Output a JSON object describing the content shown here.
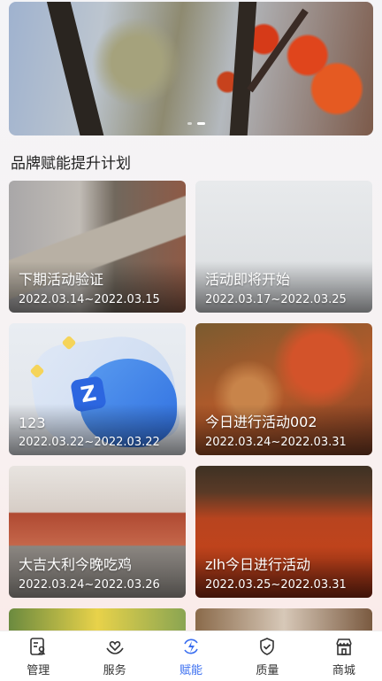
{
  "banner": {
    "slide_count": 2,
    "active_index": 1
  },
  "section_title": "品牌赋能提升计划",
  "cards": [
    {
      "name": "下期活动验证",
      "date": "2022.03.14~2022.03.15"
    },
    {
      "name": "活动即将开始",
      "date": "2022.03.17~2022.03.25"
    },
    {
      "name": "123",
      "date": "2022.03.22~2022.03.22"
    },
    {
      "name": "今日进行活动002",
      "date": "2022.03.24~2022.03.31"
    },
    {
      "name": "大吉大利今晚吃鸡",
      "date": "2022.03.24~2022.03.26"
    },
    {
      "name": "zlh今日进行活动",
      "date": "2022.03.25~2022.03.31"
    }
  ],
  "tabbar": {
    "items": [
      {
        "label": "管理",
        "icon": "management-icon"
      },
      {
        "label": "服务",
        "icon": "service-icon"
      },
      {
        "label": "赋能",
        "icon": "empower-icon",
        "active": true
      },
      {
        "label": "质量",
        "icon": "quality-shield-icon"
      },
      {
        "label": "商城",
        "icon": "store-icon"
      }
    ],
    "active_color": "#3b6ff0"
  }
}
